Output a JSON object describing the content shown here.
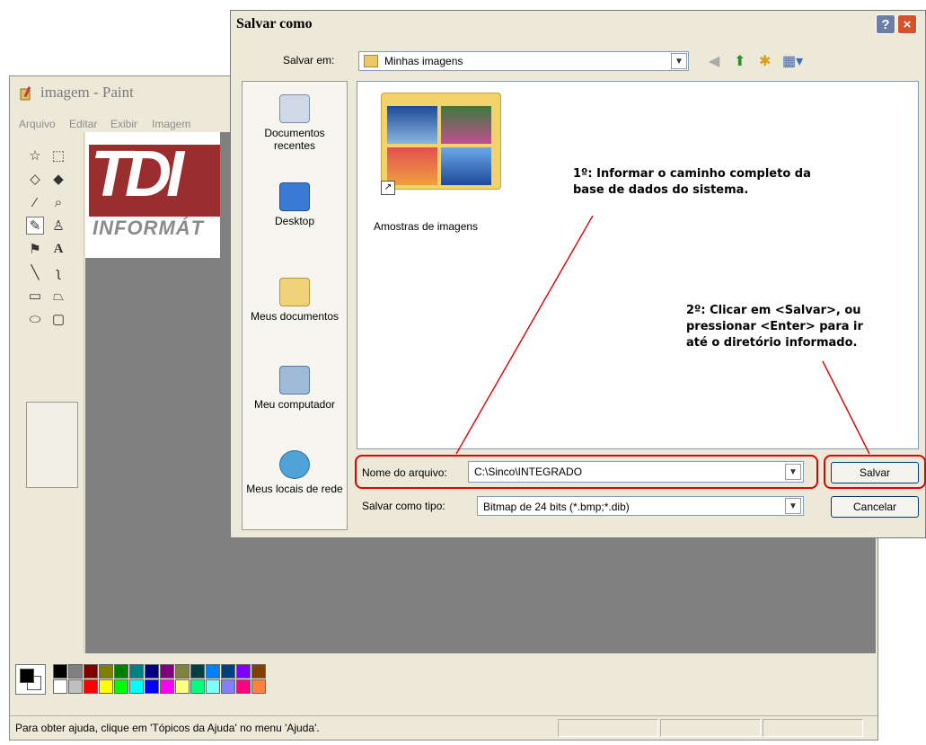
{
  "paint": {
    "title": "imagem - Paint",
    "menu": [
      "Arquivo",
      "Editar",
      "Exibir",
      "Imagem"
    ],
    "canvas_logo_text": "TDI",
    "canvas_logo_subtext": "INFORMÁT",
    "status_text": "Para obter ajuda, clique em 'Tópicos da Ajuda' no menu 'Ajuda'.",
    "palette_top": [
      "#000000",
      "#808080",
      "#800000",
      "#808000",
      "#008000",
      "#008080",
      "#000080",
      "#800080",
      "#808040",
      "#004040",
      "#0080ff",
      "#004080",
      "#8000ff",
      "#804000"
    ],
    "palette_bottom": [
      "#ffffff",
      "#c0c0c0",
      "#ff0000",
      "#ffff00",
      "#00ff00",
      "#00ffff",
      "#0000ff",
      "#ff00ff",
      "#ffff80",
      "#00ff80",
      "#80ffff",
      "#8080ff",
      "#ff0080",
      "#ff8040"
    ]
  },
  "dialog": {
    "title": "Salvar como",
    "help_button": "?",
    "close_button": "×",
    "lookin_label": "Salvar em:",
    "lookin_value": "Minhas imagens",
    "places": [
      {
        "label": "Documentos recentes",
        "icon": "recent-documents-icon"
      },
      {
        "label": "Desktop",
        "icon": "desktop-icon"
      },
      {
        "label": "Meus documentos",
        "icon": "my-documents-icon"
      },
      {
        "label": "Meu computador",
        "icon": "my-computer-icon"
      },
      {
        "label": "Meus locais de rede",
        "icon": "network-places-icon"
      }
    ],
    "folder_item": "Amostras de imagens",
    "filename_label": "Nome do arquivo:",
    "filename_value": "C:\\Sinco\\INTEGRADO",
    "filetype_label": "Salvar como tipo:",
    "filetype_value": "Bitmap de 24 bits (*.bmp;*.dib)",
    "save_button": "Salvar",
    "cancel_button": "Cancelar"
  },
  "annotations": {
    "step1": "1º: Informar o caminho completo da\nbase de dados do sistema.",
    "step2": "2º: Clicar em <Salvar>, ou\npressionar <Enter> para ir\naté o diretório informado."
  },
  "colors": {
    "highlight": "#e00000",
    "logo_red": "#9a2e2e"
  }
}
